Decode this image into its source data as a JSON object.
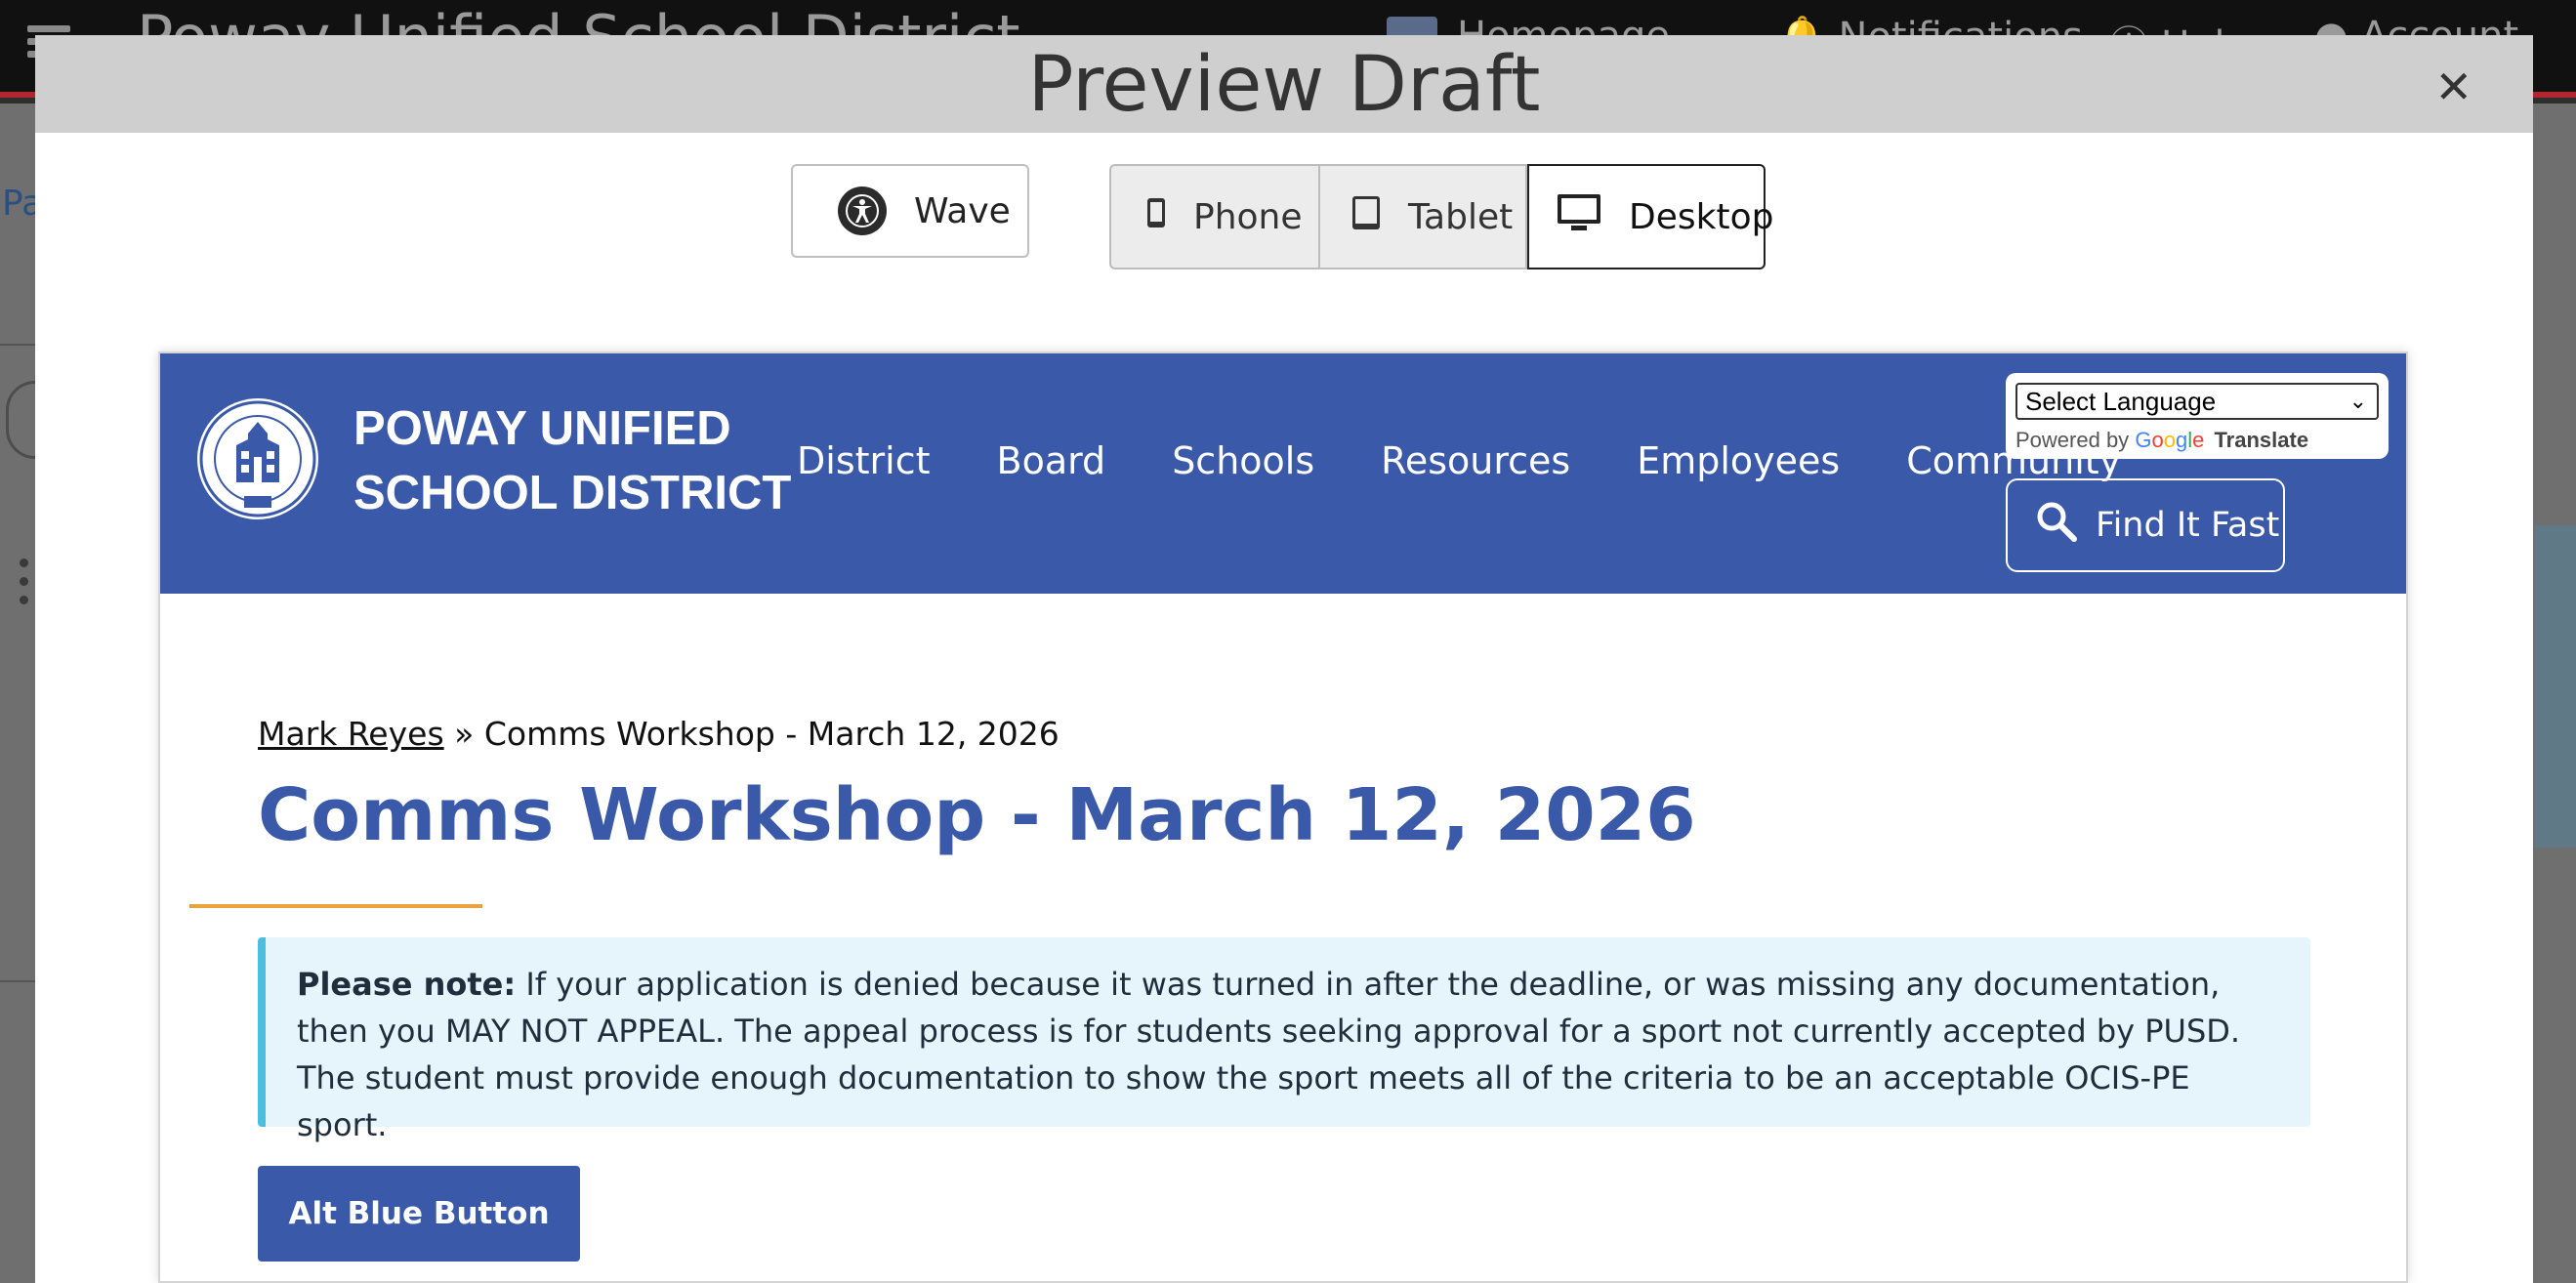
{
  "background_app": {
    "title": "Poway Unified School District",
    "nav": [
      "Homepage",
      "Notifications",
      "Help",
      "Account"
    ],
    "crumb": "Pa"
  },
  "modal": {
    "title": "Preview Draft",
    "close_icon": "close-icon",
    "wave_button": "Wave",
    "devices": {
      "phone": "Phone",
      "tablet": "Tablet",
      "desktop": "Desktop",
      "selected": "Desktop"
    }
  },
  "site": {
    "org_line1": "POWAY UNIFIED",
    "org_line2": "SCHOOL DISTRICT",
    "nav": [
      "District",
      "Board",
      "Schools",
      "Resources",
      "Employees",
      "Community"
    ],
    "language_select": "Select Language",
    "powered_by": "Powered by",
    "google": "Google",
    "translate": "Translate",
    "find_it_fast": "Find It Fast",
    "colors": {
      "header": "#3a59a8",
      "accent_underline": "#e8a33d",
      "note_border": "#4bbfe0",
      "note_bg": "#e6f5fb"
    }
  },
  "content": {
    "breadcrumb_link": "Mark Reyes",
    "breadcrumb_sep": "»",
    "breadcrumb_current": "Comms Workshop - March 12, 2026",
    "title": "Comms Workshop - March 12, 2026",
    "note_label": "Please note:",
    "note_text": "If your application is denied because it was turned in after the deadline, or was missing any documentation, then you MAY NOT APPEAL. The appeal process is for students seeking approval for a sport not currently accepted by PUSD. The student must provide enough documentation to show the sport meets all of the criteria to be an acceptable OCIS-PE sport.",
    "alt_button": "Alt Blue Button"
  }
}
